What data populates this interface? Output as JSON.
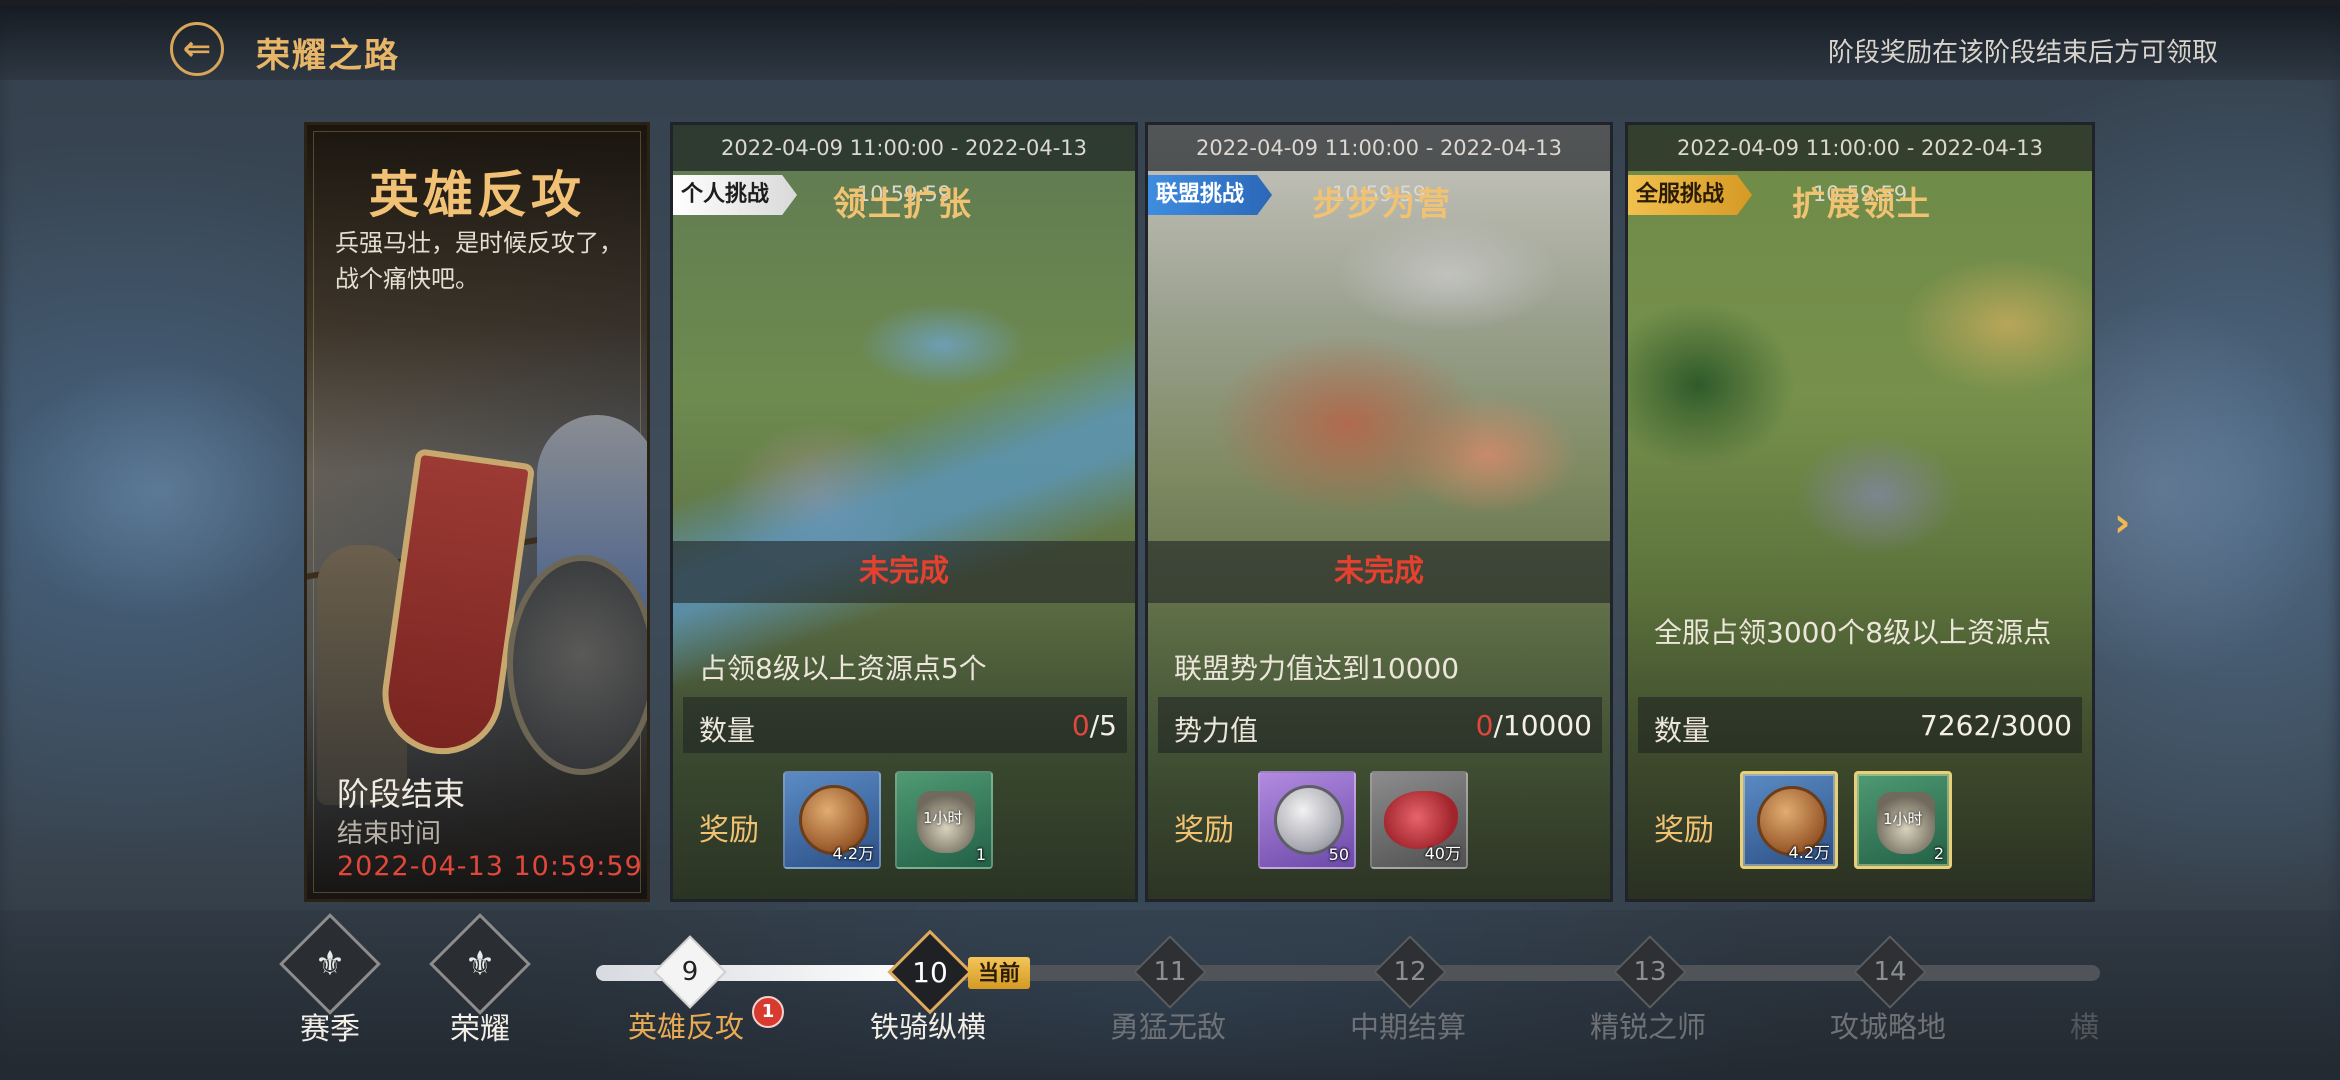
{
  "header": {
    "back_icon": "arrow-left-icon",
    "title": "荣耀之路",
    "note": "阶段奖励在该阶段结束后方可领取"
  },
  "hero": {
    "title": "英雄反攻",
    "description": "兵强马壮，是时候反攻了，战个痛快吧。",
    "stage_status": "阶段结束",
    "end_label": "结束时间",
    "end_time": "2022-04-13 10:59:59"
  },
  "cards": [
    {
      "time": "2022-04-09 11:00:00 - 2022-04-13 10:59:59",
      "tag": "个人挑战",
      "name": "领土扩张",
      "status": "未完成",
      "task": "占领8级以上资源点5个",
      "progress_label": "数量",
      "progress_current": "0",
      "progress_total": "/5",
      "reward_label": "奖励",
      "rewards": [
        {
          "icon": "bronze-coin-icon",
          "amount": "4.2万"
        },
        {
          "icon": "speedup-potion-icon",
          "badge": "1小时",
          "amount": "1"
        }
      ]
    },
    {
      "time": "2022-04-09 11:00:00 - 2022-04-13 10:59:59",
      "tag": "联盟挑战",
      "name": "步步为营",
      "status": "未完成",
      "task": "联盟势力值达到10000",
      "progress_label": "势力值",
      "progress_current": "0",
      "progress_total": "/10000",
      "reward_label": "奖励",
      "rewards": [
        {
          "icon": "silver-coin-icon",
          "amount": "50"
        },
        {
          "icon": "meat-food-icon",
          "amount": "40万"
        }
      ]
    },
    {
      "time": "2022-04-09 11:00:00 - 2022-04-13 10:59:59",
      "tag": "全服挑战",
      "name": "扩展领土",
      "task": "全服占领3000个8级以上资源点",
      "progress_label": "数量",
      "progress_value": "7262/3000",
      "reward_label": "奖励",
      "rewards": [
        {
          "icon": "bronze-coin-icon",
          "amount": "4.2万"
        },
        {
          "icon": "speedup-potion-icon",
          "badge": "1小时",
          "amount": "2"
        }
      ]
    }
  ],
  "nav": {
    "season_label": "赛季",
    "glory_label": "荣耀"
  },
  "stages": [
    {
      "num": "9",
      "label": "英雄反攻",
      "state": "done",
      "badge": "1"
    },
    {
      "num": "10",
      "label": "铁骑纵横",
      "state": "current",
      "current_tag": "当前"
    },
    {
      "num": "11",
      "label": "勇猛无敌",
      "state": "locked"
    },
    {
      "num": "12",
      "label": "中期结算",
      "state": "locked"
    },
    {
      "num": "13",
      "label": "精锐之师",
      "state": "locked"
    },
    {
      "num": "14",
      "label": "攻城略地",
      "state": "locked"
    },
    {
      "label": "横",
      "state": "locked"
    }
  ],
  "colors": {
    "accent_gold": "#e8b668",
    "incomplete_red": "#e6402f",
    "personal_tag": "#ffffff",
    "alliance_tag": "#3f8de0",
    "server_tag": "#f2c04e"
  }
}
